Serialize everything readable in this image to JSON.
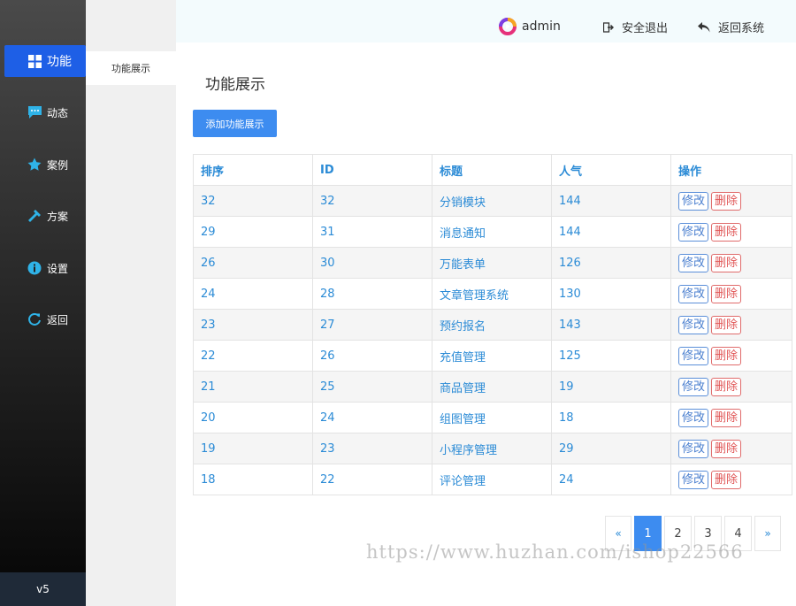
{
  "nav": {
    "items": [
      {
        "label": "功能",
        "icon": "grid-icon"
      },
      {
        "label": "动态",
        "icon": "chat-icon"
      },
      {
        "label": "案例",
        "icon": "star-icon"
      },
      {
        "label": "方案",
        "icon": "hammer-icon"
      },
      {
        "label": "设置",
        "icon": "info-icon"
      },
      {
        "label": "返回",
        "icon": "refresh-icon"
      }
    ],
    "version": "v5",
    "active_color": "#1e5fe6"
  },
  "subnav": {
    "items": [
      {
        "label": "功能展示"
      }
    ]
  },
  "header": {
    "username": "admin",
    "logout_label": "安全退出",
    "back_label": "返回系统"
  },
  "main": {
    "title": "功能展示",
    "add_button": "添加功能展示",
    "table": {
      "headers": [
        "排序",
        "ID",
        "标题",
        "人气",
        "操作"
      ],
      "edit_label": "修改",
      "delete_label": "删除",
      "rows": [
        {
          "sort": "32",
          "id": "32",
          "title": "分销模块",
          "views": "144"
        },
        {
          "sort": "29",
          "id": "31",
          "title": "消息通知",
          "views": "144"
        },
        {
          "sort": "26",
          "id": "30",
          "title": "万能表单",
          "views": "126"
        },
        {
          "sort": "24",
          "id": "28",
          "title": "文章管理系统",
          "views": "130"
        },
        {
          "sort": "23",
          "id": "27",
          "title": "预约报名",
          "views": "143"
        },
        {
          "sort": "22",
          "id": "26",
          "title": "充值管理",
          "views": "125"
        },
        {
          "sort": "21",
          "id": "25",
          "title": "商品管理",
          "views": "19"
        },
        {
          "sort": "20",
          "id": "24",
          "title": "组图管理",
          "views": "18"
        },
        {
          "sort": "19",
          "id": "23",
          "title": "小程序管理",
          "views": "29"
        },
        {
          "sort": "18",
          "id": "22",
          "title": "评论管理",
          "views": "24"
        }
      ]
    },
    "pagination": {
      "prev": "«",
      "next": "»",
      "pages": [
        "1",
        "2",
        "3",
        "4"
      ],
      "current": "1"
    }
  },
  "watermark": "https://www.huzhan.com/ishop22566",
  "colors": {
    "link_blue": "#2b8bd6",
    "primary": "#3d8cf0",
    "danger": "#e05555"
  }
}
